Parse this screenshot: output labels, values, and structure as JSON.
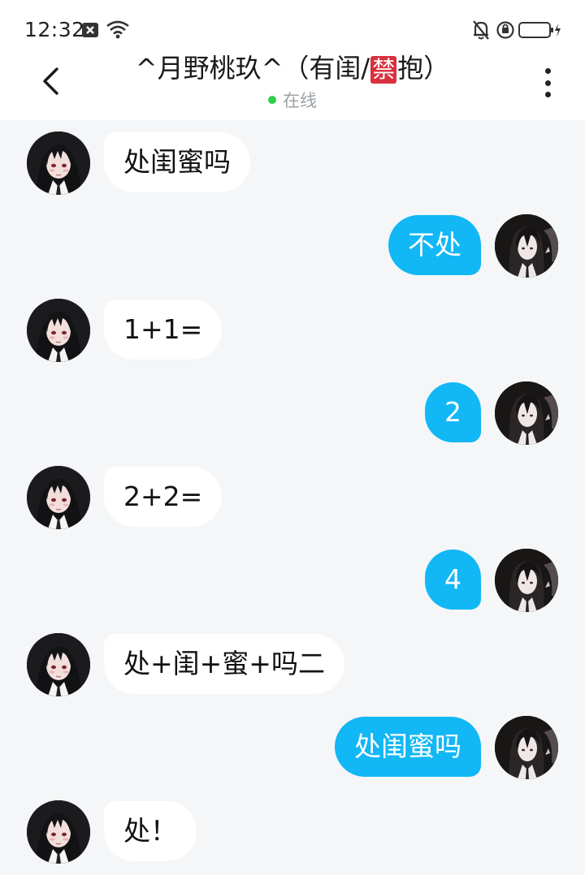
{
  "status_bar": {
    "time": "12:32",
    "icons": [
      "close-box-icon",
      "wifi-icon",
      "mute-bell-icon",
      "alarm-icon",
      "battery-charging-icon"
    ]
  },
  "header": {
    "title_prefix": "^月野桃玖^（有闺/",
    "title_badge": "禁",
    "title_suffix": "抱）",
    "presence": "在线",
    "presence_color": "#2bd14c",
    "back_icon": "chevron-left-icon",
    "more_icon": "more-vertical-icon"
  },
  "colors": {
    "incoming_bubble": "#ffffff",
    "outgoing_bubble": "#12b7f5",
    "background": "#f4f6f7"
  },
  "messages": [
    {
      "side": "in",
      "text": "处闺蜜吗"
    },
    {
      "side": "out",
      "text": "不处"
    },
    {
      "side": "in",
      "text": "1+1="
    },
    {
      "side": "out",
      "text": "2"
    },
    {
      "side": "in",
      "text": "2+2="
    },
    {
      "side": "out",
      "text": "4"
    },
    {
      "side": "in",
      "text": "处+闺+蜜+吗二"
    },
    {
      "side": "out",
      "text": "处闺蜜吗"
    },
    {
      "side": "in",
      "text": "处！"
    }
  ]
}
